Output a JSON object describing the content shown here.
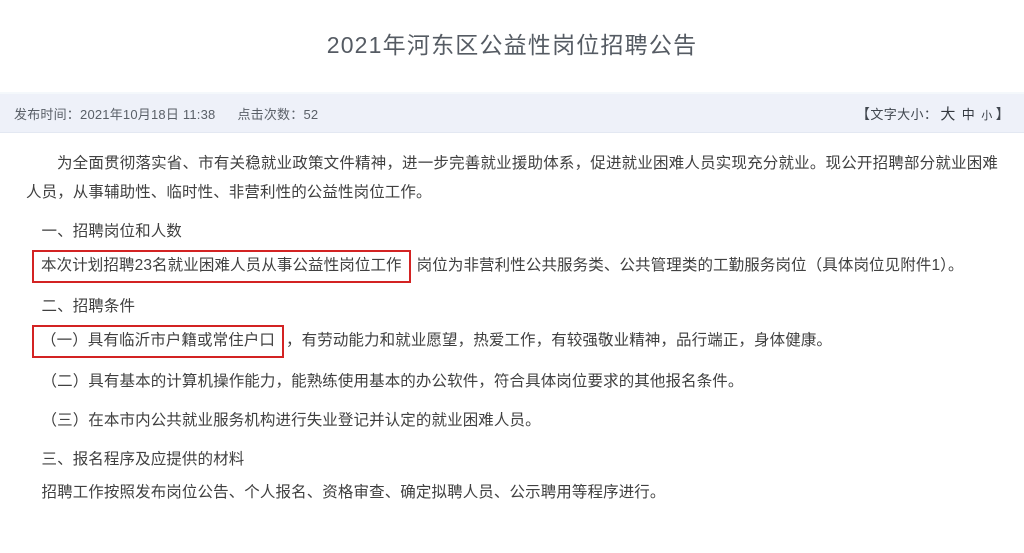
{
  "header": {
    "title": "2021年河东区公益性岗位招聘公告"
  },
  "meta": {
    "publish_label": "发布时间：",
    "publish_time": "2021年10月18日 11:38",
    "hits_label": "点击次数：",
    "hits_count": "52",
    "fontsize": {
      "bracket_open": "【",
      "label": "文字大小：",
      "large": "大",
      "medium": "中",
      "small": "小",
      "bracket_close": "】"
    }
  },
  "article": {
    "intro": "为全面贯彻落实省、市有关稳就业政策文件精神，进一步完善就业援助体系，促进就业困难人员实现充分就业。现公开招聘部分就业困难人员，从事辅助性、临时性、非营利性的公益性岗位工作。",
    "section1": {
      "heading": "一、招聘岗位和人数",
      "boxed_text": "本次计划招聘23名就业困难人员从事公益性岗位工作",
      "rest_text": "岗位为非营利性公共服务类、公共管理类的工勤服务岗位（具体岗位见附件1）。"
    },
    "section2": {
      "heading": "二、招聘条件",
      "item1_boxed": "（一）具有临沂市户籍或常住户口",
      "item1_rest": "，有劳动能力和就业愿望，热爱工作，有较强敬业精神，品行端正，身体健康。",
      "item2": "（二）具有基本的计算机操作能力，能熟练使用基本的办公软件，符合具体岗位要求的其他报名条件。",
      "item3": "（三）在本市内公共就业服务机构进行失业登记并认定的就业困难人员。"
    },
    "section3": {
      "heading": "三、报名程序及应提供的材料",
      "para": "招聘工作按照发布岗位公告、个人报名、资格审查、确定拟聘人员、公示聘用等程序进行。"
    }
  },
  "colors": {
    "annotation_red": "#d32323",
    "meta_bar_bg": "#eef1f9",
    "title_text": "#555b63"
  }
}
